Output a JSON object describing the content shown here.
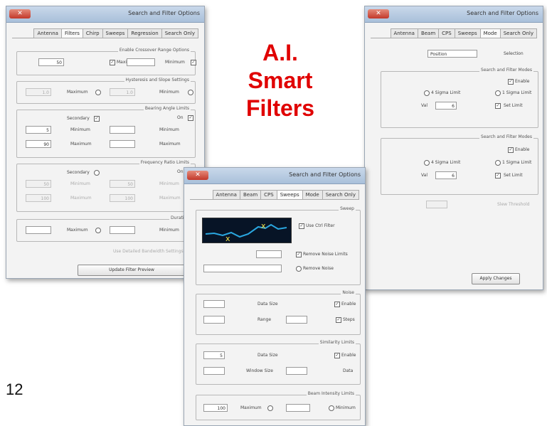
{
  "heading": {
    "line1": "A.I.",
    "line2": "Smart",
    "line3": "Filters"
  },
  "page_number": "12",
  "window_left": {
    "title": "Search and Filter Options",
    "close": "✕",
    "tabs": [
      "Antenna",
      "Filters",
      "Chirp",
      "Sweeps",
      "Regression",
      "Search Only"
    ],
    "groups": {
      "g1": "Enable Crossover Range Options",
      "g2": "Hysteresis and Slope Settings",
      "g3": "Bearing Angle Limits",
      "g4": "Frequency Ratio Limits",
      "g5": "Duration"
    },
    "labels": {
      "g1_min": "Minimum",
      "g1_max": "Maximum",
      "g2_min": "Minimum",
      "g2_max": "Maximum",
      "g3_toggle": "On",
      "g3_second": "Secondary",
      "g3_min_a": "Minimum",
      "g3_max_a": "Maximum",
      "g3_min_b": "Minimum",
      "g3_max_b": "Maximum",
      "g4_toggle": "On",
      "g4_second": "Secondary",
      "g4_min_a": "Minimum",
      "g4_max_a": "Maximum",
      "g4_min_b": "Minimum",
      "g4_max_b": "Maximum",
      "g5_min": "Minimum",
      "g5_max": "Maximum",
      "footer_note": "Use Detailed Bandwidth Settings"
    },
    "values": {
      "g1_a": "",
      "g1_b": "50",
      "g2_a": "1.0",
      "g2_b": "1.0",
      "g3_a": "",
      "g3_b": "5",
      "g3_c": "",
      "g3_d": "90",
      "g4_a": "50",
      "g4_b": "50",
      "g4_c": "100",
      "g4_d": "100",
      "g5_a": "",
      "g5_b": ""
    },
    "button": "Update Filter Preview"
  },
  "window_right": {
    "title": "Search and Filter Options",
    "close": "✕",
    "tabs": [
      "Antenna",
      "Beam",
      "CPS",
      "Sweeps",
      "Mode",
      "Search Only"
    ],
    "select_label": "Selection",
    "select_value": "Position",
    "group1": "Search and Filter Modes",
    "group2": "Search and Filter Modes",
    "g1_enable": "Enable",
    "g1_opt_a": "1 Sigma Limit",
    "g1_opt_b": "4 Sigma Limit",
    "g1_opt_c": "Set Limit",
    "g1_val_label": "Val",
    "g1_val": "6",
    "g2_enable": "Enable",
    "g2_opt_a": "1 Sigma Limit",
    "g2_opt_b": "4 Sigma Limit",
    "g2_opt_c": "Set Limit",
    "g2_val_label": "Val",
    "g2_val": "6",
    "dim_label": "Slew Threshold",
    "button": "Apply Changes"
  },
  "window_center": {
    "title": "Search and Filter Options",
    "close": "✕",
    "tabs": [
      "Antenna",
      "Beam",
      "CPS",
      "Sweeps",
      "Mode",
      "Search Only"
    ],
    "grp_top": "Sweep",
    "preview_label": "Use Ctrl Filter",
    "opt_a": "Remove Noise Limits",
    "opt_b": "Remove Noise",
    "val_a": "",
    "grp_noise": "Noise",
    "noise_enable": "Enable",
    "noise_datasize": "Data Size",
    "noise_range": "Range",
    "noise_steps": "Steps",
    "noise_v1": "",
    "noise_v2": "",
    "noise_v3": "",
    "grp_sim": "Similarity Limits",
    "sim_enable": "Enable",
    "sim_datasize": "Data Size",
    "sim_window": "Window Size",
    "sim_data": "Data",
    "sim_v1": "5",
    "sim_v2": "",
    "sim_v3": "",
    "grp_bottom": "Beam Intensity Limits",
    "bot_min": "Minimum",
    "bot_max": "Maximum",
    "bot_v1": "",
    "bot_v2": "100"
  },
  "colors": {
    "accent": "#e00000",
    "titlebar": "#b9cde3",
    "preview_bg": "#071426"
  }
}
